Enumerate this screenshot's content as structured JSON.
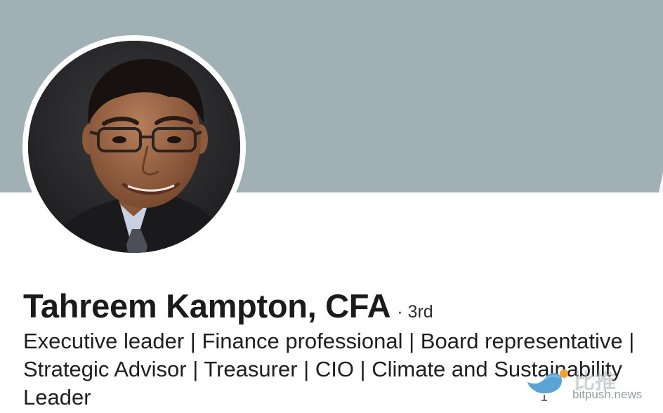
{
  "profile": {
    "name": "Tahreem Kampton, CFA",
    "connection_degree": "· 3rd",
    "headline": "Executive leader | Finance professional | Board representative | Strategic Advisor | Treasurer | CIO | Climate and Sustainability Leader"
  },
  "cover": {
    "color": "#a0b0b4"
  },
  "avatar": {
    "icon": "profile-photo"
  },
  "watermark": {
    "chinese_text": "比推",
    "url_text": "bitpush.news",
    "icon": "bird-logo-icon"
  }
}
